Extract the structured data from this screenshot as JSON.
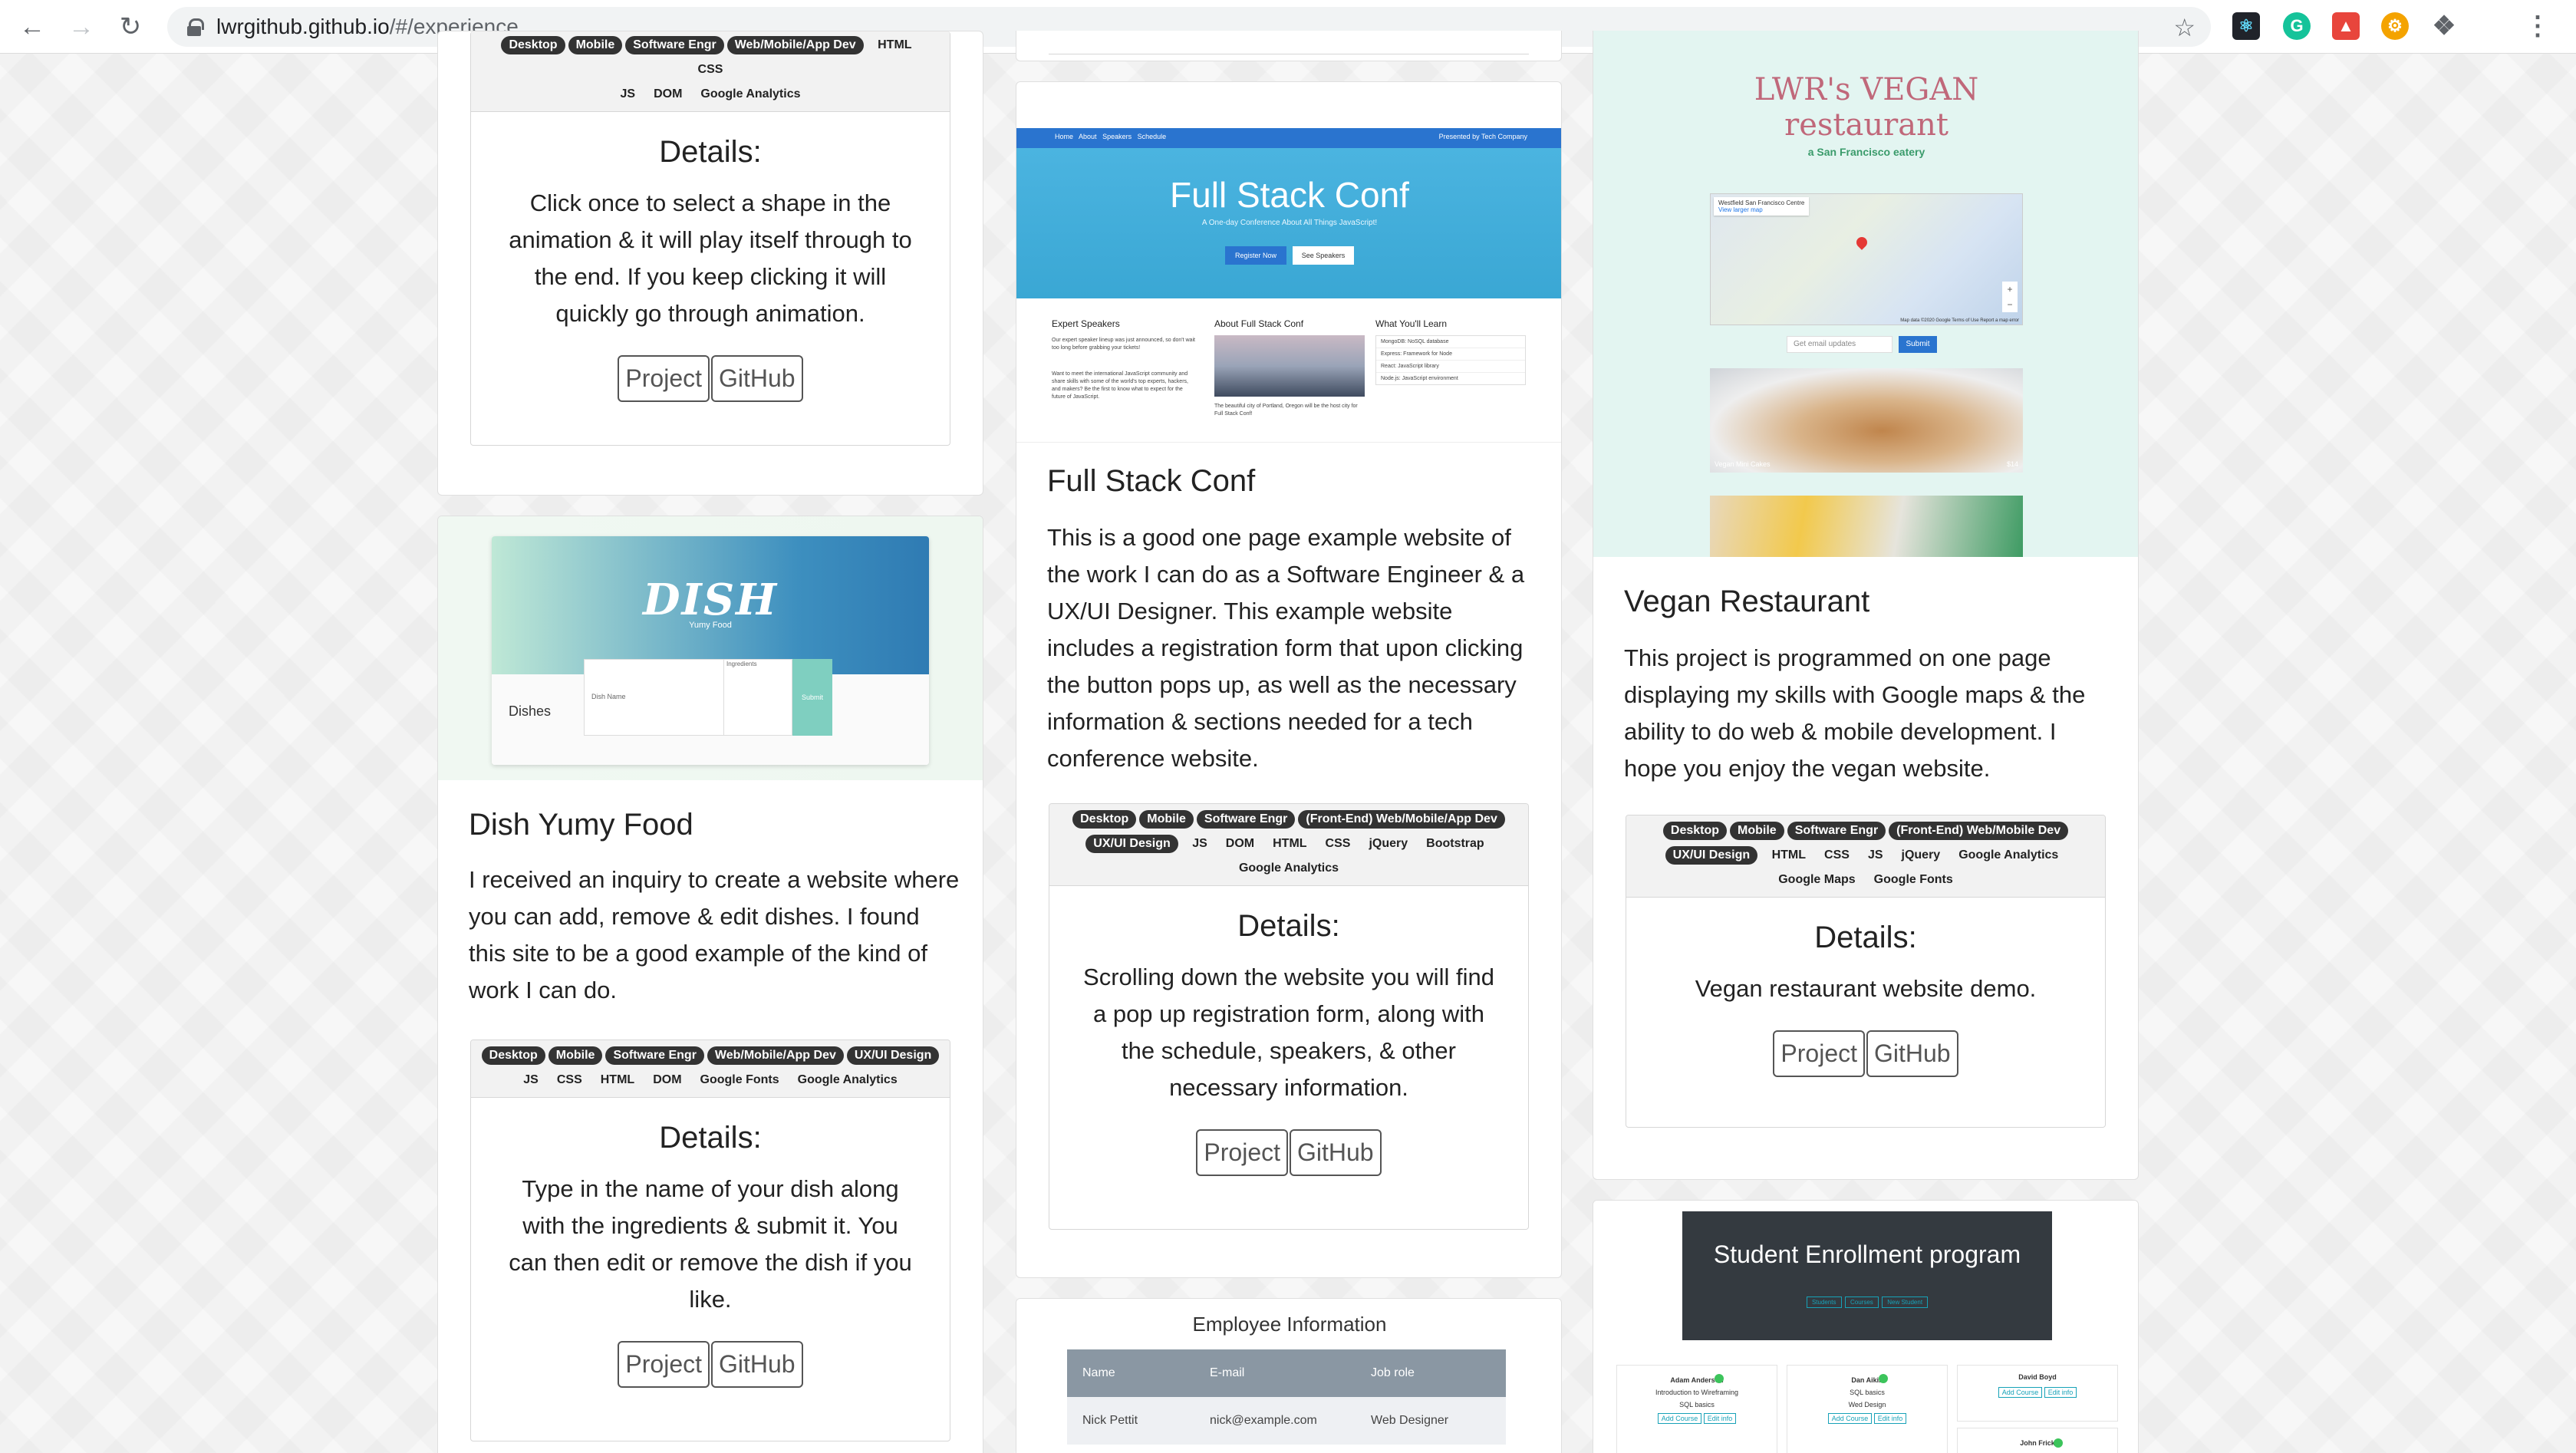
{
  "browser": {
    "url_host": "lwrgithub.github.io",
    "url_path": "/#/experience"
  },
  "col1_top": {
    "tags_row1": [
      "Desktop",
      "Mobile",
      "Software Engr",
      "Web/Mobile/App Dev"
    ],
    "tags_row1_plain": [
      "HTML",
      "CSS"
    ],
    "tags_row2_plain": [
      "JS",
      "DOM",
      "Google Analytics"
    ],
    "details_title": "Details:",
    "details_text": "Click once to select a shape in the animation & it will play itself through to the end. If you keep clicking it will quickly go through animation.",
    "project_label": "Project",
    "github_label": "GitHub"
  },
  "dish": {
    "thumb_logo": "DISH",
    "thumb_sub": "Yumy Food",
    "thumb_side": "Dishes",
    "thumb_field": "Dish Name",
    "thumb_field2": "Ingredients",
    "thumb_btn": "Submit",
    "title": "Dish Yumy Food",
    "desc": "I received an inquiry to create a website where you can add, remove & edit dishes. I found this site to be a good example of the kind of work I can do.",
    "tags_row1": [
      "Desktop",
      "Mobile",
      "Software Engr",
      "Web/Mobile/App Dev",
      "UX/UI Design"
    ],
    "tags_row2_plain": [
      "JS",
      "CSS",
      "HTML",
      "DOM",
      "Google Fonts",
      "Google Analytics"
    ],
    "details_title": "Details:",
    "details_text": "Type in the name of your dish along with the ingredients & submit it. You can then edit or remove the dish if you like.",
    "project_label": "Project",
    "github_label": "GitHub"
  },
  "fullstack": {
    "thumb_nav": [
      "Home",
      "About",
      "Speakers",
      "Schedule"
    ],
    "thumb_presented": "Presented by Tech Company",
    "thumb_title": "Full Stack Conf",
    "thumb_tagline": "A One-day Conference About All Things JavaScript!",
    "thumb_btn1": "Register Now",
    "thumb_btn2": "See Speakers",
    "thumb_col1_title": "Expert Speakers",
    "thumb_col2_title": "About Full Stack Conf",
    "thumb_col3_title": "What You'll Learn",
    "thumb_col1_text": "Our expert speaker lineup was just announced, so don't wait too long before grabbing your tickets!",
    "thumb_col1_text2": "Want to meet the international JavaScript community and share skills with some of the world's top experts, hackers, and makers? Be the first to know what to expect for the future of JavaScript.",
    "thumb_col2_caption": "The beautiful city of Portland, Oregon will be the host city for Full Stack Conf!",
    "thumb_learn": [
      "MongoDB: NoSQL database",
      "Express: Framework for Node",
      "React: JavaScript library",
      "Node.js: JavaScript environment"
    ],
    "title": "Full Stack Conf",
    "desc": "This is a good one page example website of the work I can do as a Software Engineer & a UX/UI Designer. This example website includes a registration form that upon clicking the button pops up, as well as the necessary information & sections needed for a tech conference website.",
    "tags_row1": [
      "Desktop",
      "Mobile",
      "Software Engr",
      "(Front-End) Web/Mobile/App Dev"
    ],
    "tags_row2_pill": [
      "UX/UI Design"
    ],
    "tags_row2_plain": [
      "JS",
      "DOM",
      "HTML",
      "CSS",
      "jQuery",
      "Bootstrap"
    ],
    "tags_row3_plain": [
      "Google Analytics"
    ],
    "details_title": "Details:",
    "details_text": "Scrolling down the website you will find a pop up registration form, along with the schedule, speakers, & other necessary information.",
    "project_label": "Project",
    "github_label": "GitHub"
  },
  "employee": {
    "thumb_title": "Employee Information",
    "headers": [
      "Name",
      "E-mail",
      "Job role"
    ],
    "rows": [
      [
        "Nick Pettit",
        "nick@example.com",
        "Web Designer"
      ]
    ]
  },
  "vegan": {
    "thumb_title1": "LWR's VEGAN",
    "thumb_title2": "restaurant",
    "thumb_sub": "a San Francisco eatery",
    "thumb_map_label": "Westfield San Francisco Centre",
    "thumb_map_link": "View larger map",
    "thumb_map_footer": "Map data ©2020 Google  Terms of Use  Report a map error",
    "thumb_email_placeholder": "Get email updates",
    "thumb_submit": "Submit",
    "thumb_food_label": "Vegan Mini Cakes",
    "thumb_food_price": "$14",
    "title": "Vegan Restaurant",
    "desc": "This project is programmed on one page displaying my skills with Google maps & the ability to do web & mobile development. I hope you enjoy the vegan website.",
    "tags_row1": [
      "Desktop",
      "Mobile",
      "Software Engr",
      "(Front-End) Web/Mobile Dev"
    ],
    "tags_row2_pill": [
      "UX/UI Design"
    ],
    "tags_row2_plain": [
      "HTML",
      "CSS",
      "JS",
      "jQuery",
      "Google Analytics"
    ],
    "tags_row3_plain": [
      "Google Maps",
      "Google Fonts"
    ],
    "details_title": "Details:",
    "details_text": "Vegan restaurant website demo.",
    "project_label": "Project",
    "github_label": "GitHub"
  },
  "student": {
    "thumb_title": "Student Enrollment program",
    "thumb_btns": [
      "Students",
      "Courses",
      "New Student"
    ],
    "cards": [
      {
        "name": "Adam Anderson",
        "line1": "Introduction to Wireframing",
        "line2": "SQL basics",
        "b1": "Add Course",
        "b2": "Edit info"
      },
      {
        "name": "Dan Aikin",
        "line1": "SQL basics",
        "line2": "Wed Design",
        "b1": "Add Course",
        "b2": "Edit info"
      },
      {
        "name": "David Boyd",
        "line1": "",
        "line2": "",
        "b1": "Add Course",
        "b2": "Edit info"
      }
    ],
    "next_name": "John Frick"
  },
  "colors": {
    "pill": "#333333",
    "fullstack_blue": "#3bb0d6",
    "vegan_bg": "#e3f5f1",
    "student_dark": "#343a40",
    "employee_head": "#8a97a3"
  }
}
